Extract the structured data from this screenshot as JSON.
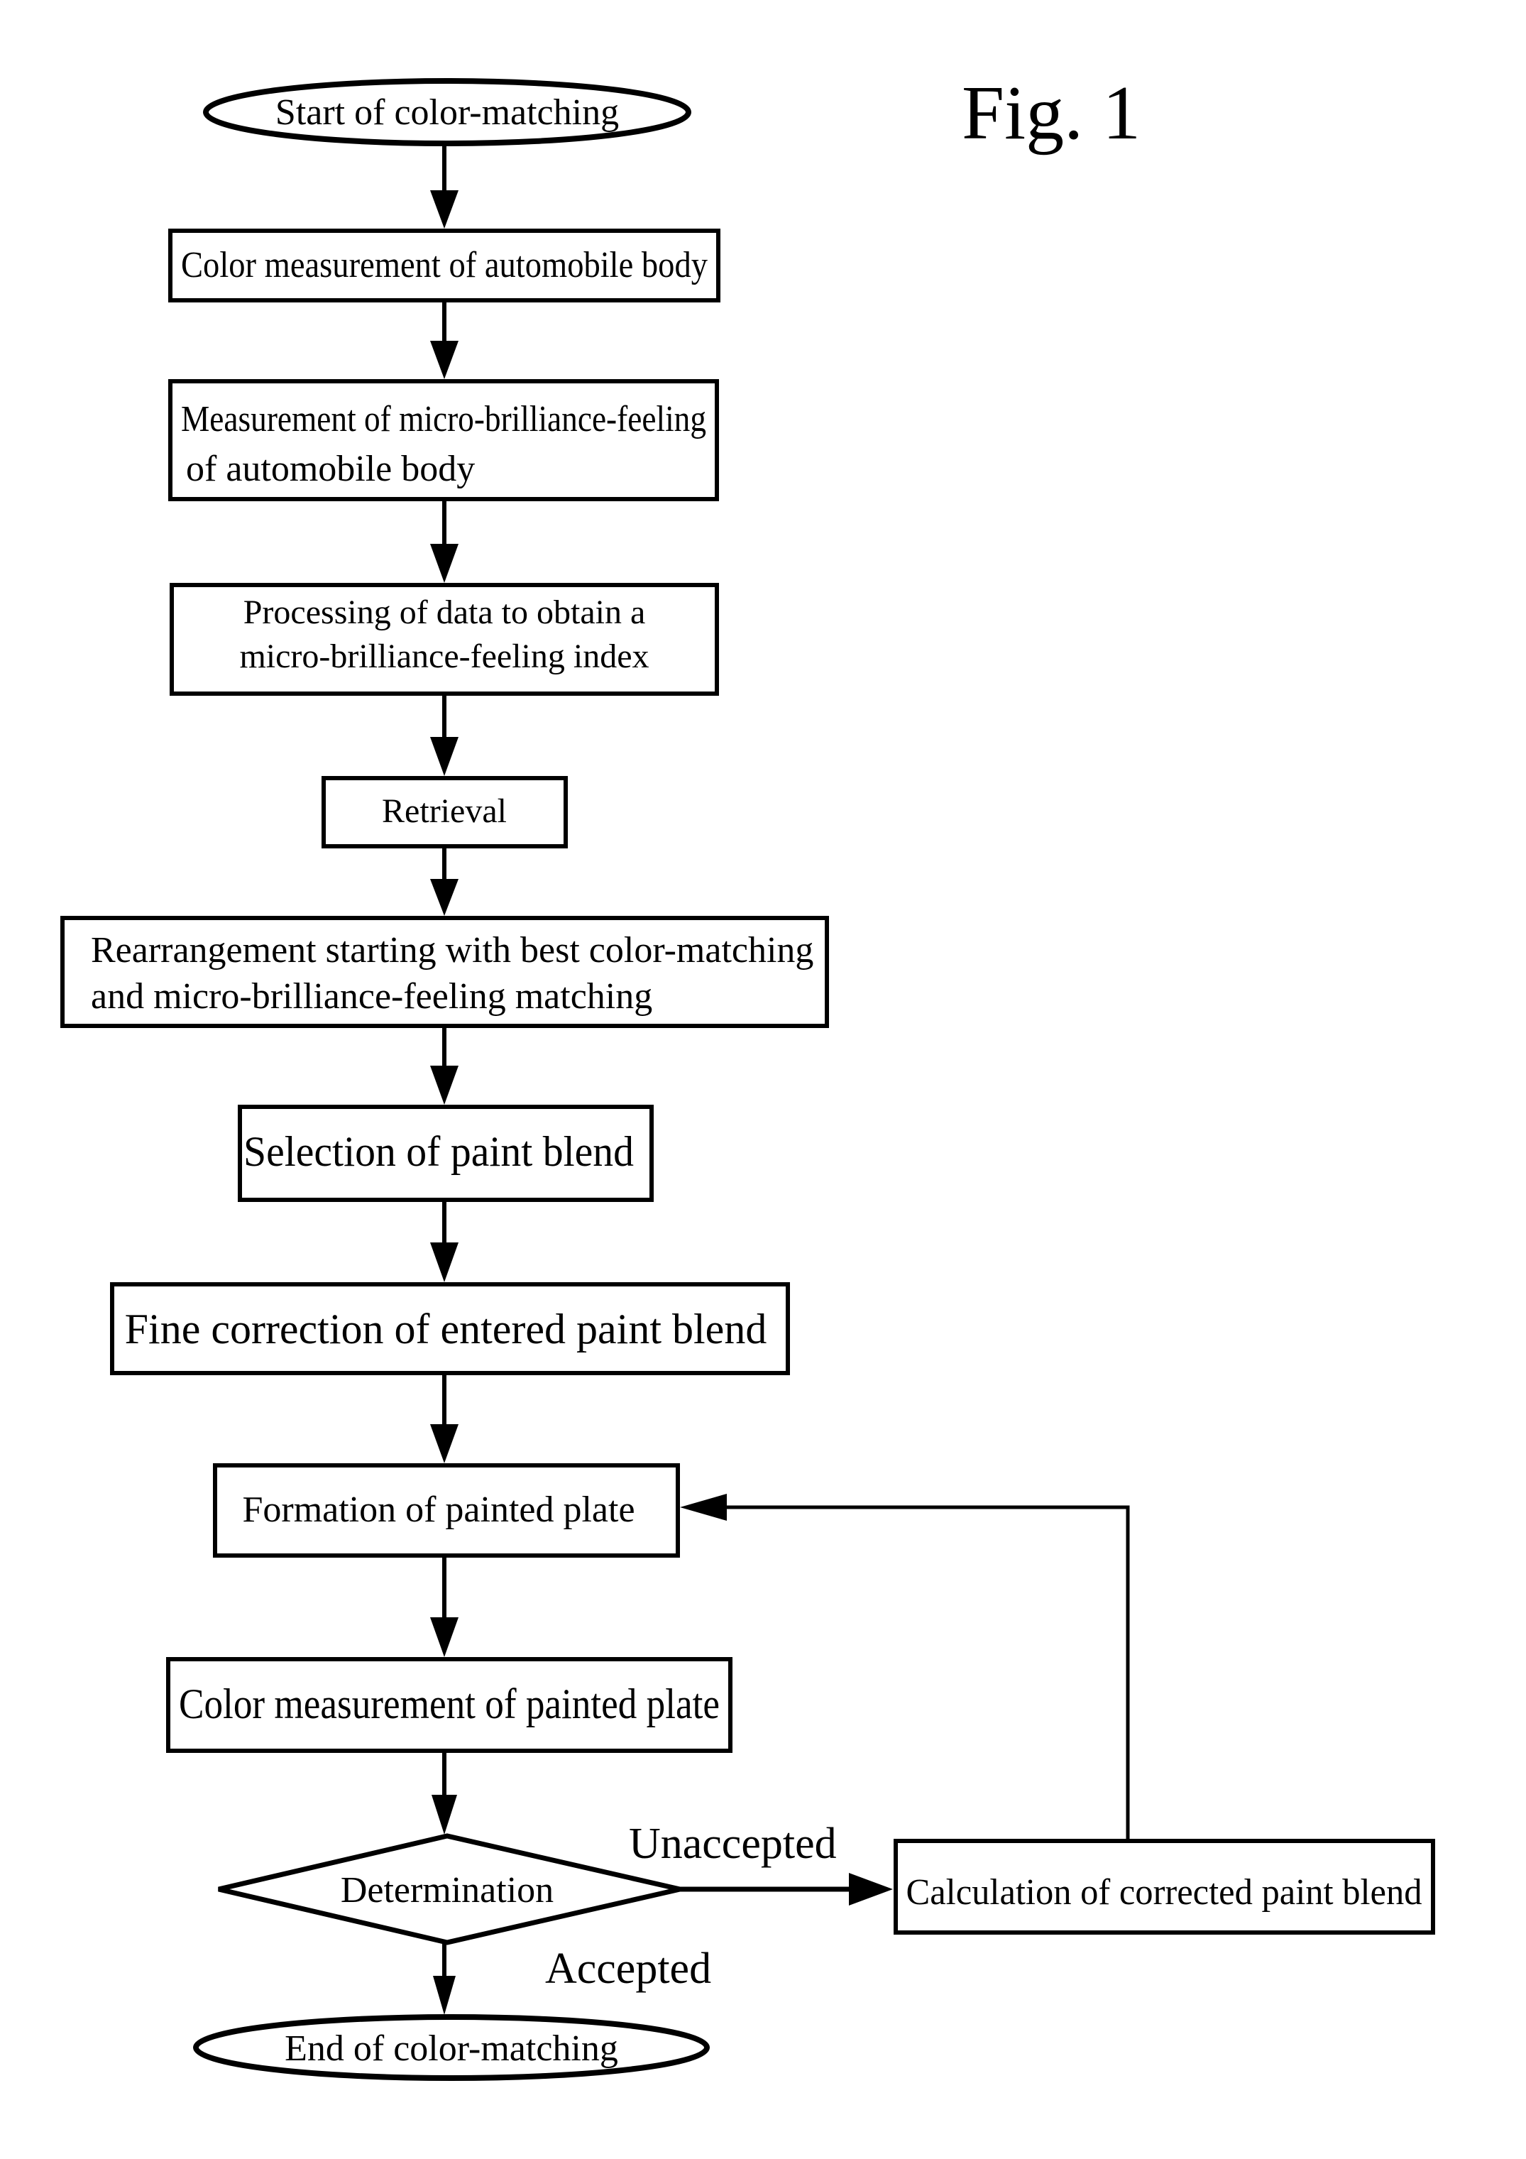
{
  "figure_label": "Fig. 1",
  "nodes": {
    "start": "Start of color-matching",
    "color_measurement_body": "Color measurement of automobile body",
    "measurement_micro_line1": "Measurement of micro-brilliance-feeling",
    "measurement_micro_line2": "of automobile body",
    "processing_line1": "Processing of data to obtain a",
    "processing_line2": "micro-brilliance-feeling index",
    "retrieval": "Retrieval",
    "rearrangement_line1": "Rearrangement starting with best color-matching",
    "rearrangement_line2": "and micro-brilliance-feeling matching",
    "selection": "Selection of paint blend",
    "fine_correction": "Fine correction of entered paint blend",
    "formation": "Formation of painted plate",
    "color_measurement_plate": "Color measurement of painted plate",
    "determination": "Determination",
    "calculation": "Calculation of corrected paint blend",
    "end": "End of color-matching"
  },
  "edge_labels": {
    "unaccepted": "Unaccepted",
    "accepted": "Accepted"
  },
  "colors": {
    "stroke": "#000000",
    "background": "#ffffff"
  }
}
